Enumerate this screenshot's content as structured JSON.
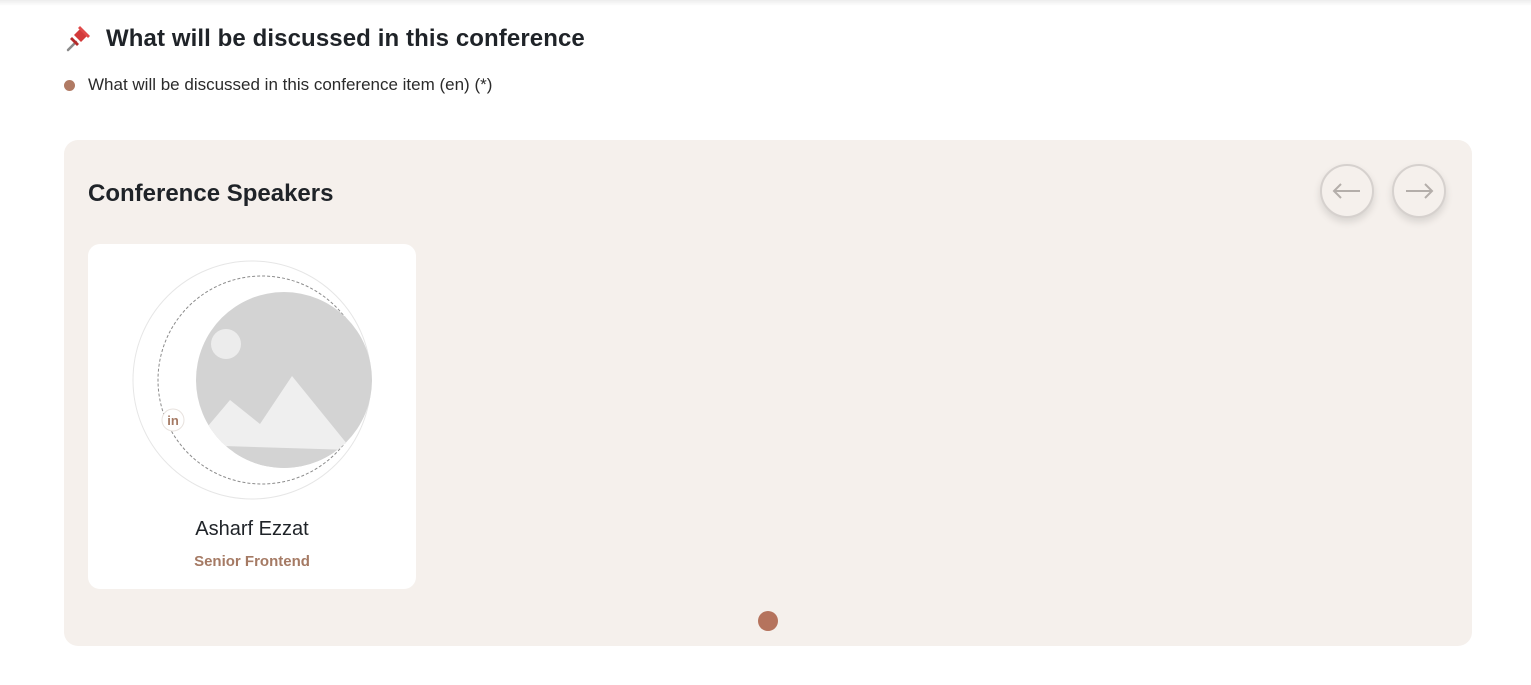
{
  "discussion": {
    "title": "What will be discussed in this conference",
    "items": [
      "What will be discussed in this conference item (en) (*)"
    ]
  },
  "speakers_section": {
    "title": "Conference Speakers",
    "speakers": [
      {
        "name": "Asharf Ezzat",
        "role": "Senior Frontend",
        "social": "in"
      }
    ],
    "page_count": 1,
    "active_page": 1
  },
  "icons": {
    "title_icon": "pushpin-icon",
    "prev": "arrow-left-icon",
    "next": "arrow-right-icon",
    "linkedin": "linkedin-icon"
  },
  "colors": {
    "accent": "#b5735d",
    "role_text": "#a57a64",
    "panel_bg": "#f5f0ec"
  }
}
